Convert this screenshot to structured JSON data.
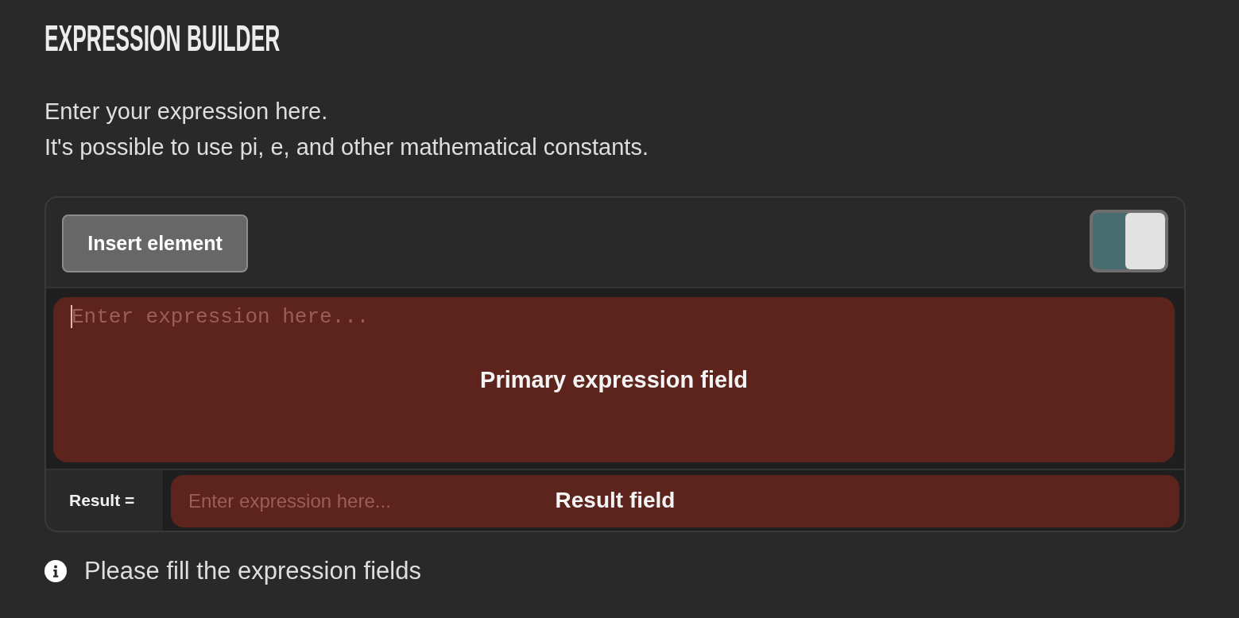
{
  "header": {
    "title": "EXPRESSION BUILDER",
    "description": [
      "Enter your expression here.",
      "It's possible to use pi, e, and other mathematical constants."
    ]
  },
  "toolbar": {
    "insert_button": "Insert element",
    "toggle": {
      "on": true
    }
  },
  "expression_field": {
    "placeholder": "Enter expression here...",
    "focused": true,
    "caption": "Primary expression field"
  },
  "result": {
    "label": "Result =",
    "field": {
      "placeholder": "Enter expression here...",
      "caption": "Result field"
    }
  },
  "message": {
    "kind": "info",
    "text": "Please fill the expression fields"
  }
}
